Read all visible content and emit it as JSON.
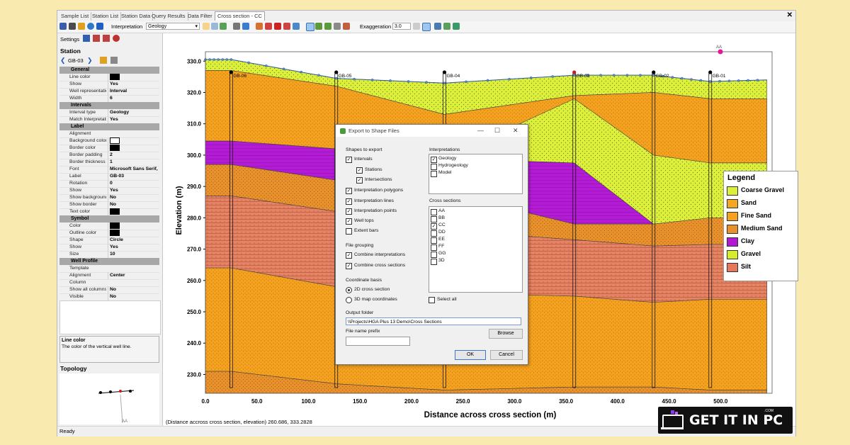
{
  "tabs": [
    {
      "label": "Sample List",
      "active": false
    },
    {
      "label": "Station List",
      "active": false
    },
    {
      "label": "Station Data",
      "active": false
    },
    {
      "label": "Query Results",
      "active": false
    },
    {
      "label": "Data Filter",
      "active": false
    },
    {
      "label": "Cross section - CC",
      "active": true
    }
  ],
  "toolbar": {
    "interpretation_label": "Interpretation",
    "interpretation_value": "Geology",
    "exaggeration_label": "Exaggeration",
    "exaggeration_value": "3.0"
  },
  "left_panel": {
    "settings_label": "Settings",
    "station_header": "Station",
    "station_id": "GB-03",
    "categories": {
      "general": "General",
      "intervals": "Intervals",
      "label": "Label",
      "symbol": "Symbol",
      "well_profile": "Well Profile"
    },
    "rows": {
      "line_color": "Line color",
      "show": "Show",
      "show_value": "Yes",
      "well_representation": "Well representation",
      "well_representation_value": "Interval",
      "width": "Width",
      "width_value": "6",
      "interval_type": "Interval type",
      "interval_type_value": "Geology",
      "match_interpretation": "Match Interpretation",
      "match_interpretation_value": "Yes",
      "alignment": "Alignment",
      "background_color": "Background color",
      "border_color": "Border color",
      "border_padding": "Border padding",
      "border_padding_value": "2",
      "border_thickness": "Border thickness",
      "border_thickness_value": "1",
      "font": "Font",
      "font_value": "Microsoft Sans Serif,",
      "label": "Label",
      "label_value": "GB-03",
      "rotation": "Rotation",
      "rotation_value": "0",
      "show_label": "Show",
      "show_label_value": "Yes",
      "show_background": "Show background",
      "show_background_value": "No",
      "show_border": "Show border",
      "show_border_value": "No",
      "text_color": "Text color",
      "color": "Color",
      "outline_color": "Outline color",
      "shape": "Shape",
      "shape_value": "Circle",
      "symbol_show": "Show",
      "symbol_show_value": "Yes",
      "size": "Size",
      "size_value": "10",
      "template": "Template",
      "wp_alignment": "Alignment",
      "wp_alignment_value": "Center",
      "column": "Column",
      "show_all_columns": "Show all columns",
      "show_all_columns_value": "No",
      "visible": "Visible",
      "visible_value": "No"
    },
    "description_title": "Line color",
    "description_text": "The color of the vertical well line.",
    "topology_header": "Topology",
    "topology_label_aa": "AA"
  },
  "section": {
    "y_axis_label": "Elevation (m)",
    "x_axis_label": "Distance across cross section (m)",
    "y_ticks": [
      "330.0",
      "320.0",
      "310.0",
      "300.0",
      "290.0",
      "280.0",
      "270.0",
      "260.0",
      "250.0",
      "240.0",
      "230.0"
    ],
    "x_ticks": [
      "0.0",
      "50.0",
      "100.0",
      "150.0",
      "200.0",
      "250.0",
      "300.0",
      "350.0",
      "400.0",
      "450.0",
      "500.0"
    ],
    "wells": [
      "GB-06",
      "GB-05",
      "GB-04",
      "GB-03",
      "GB-02",
      "GB-01"
    ],
    "marker_label": "AA"
  },
  "legend": {
    "title": "Legend",
    "items": [
      {
        "label": "Coarse Gravel",
        "color": "#dff24a"
      },
      {
        "label": "Sand",
        "color": "#f5a623"
      },
      {
        "label": "Fine Sand",
        "color": "#f4a21f"
      },
      {
        "label": "Medium Sand",
        "color": "#e8902a"
      },
      {
        "label": "Clay",
        "color": "#b218d4"
      },
      {
        "label": "Gravel",
        "color": "#d8ec2e"
      },
      {
        "label": "Silt",
        "color": "#e5775a"
      }
    ]
  },
  "dialog": {
    "title": "Export to Shape Files",
    "shapes_label": "Shapes to export",
    "shapes": [
      {
        "label": "Intervals",
        "checked": true
      },
      {
        "label": "Stations",
        "checked": true
      },
      {
        "label": "Intersections",
        "checked": true
      },
      {
        "label": "Interpretation polygons",
        "checked": true
      },
      {
        "label": "Interpretation lines",
        "checked": true
      },
      {
        "label": "Interpretation points",
        "checked": true
      },
      {
        "label": "Well tops",
        "checked": true
      },
      {
        "label": "Extent bars",
        "checked": false
      }
    ],
    "file_grouping_label": "File grouping",
    "file_grouping": [
      {
        "label": "Combine interpretations",
        "checked": true
      },
      {
        "label": "Combine cross sections",
        "checked": true
      }
    ],
    "coord_label": "Coordinate basis",
    "coord_options": [
      {
        "label": "2D cross section",
        "selected": true
      },
      {
        "label": "3D map coordinates",
        "selected": false
      }
    ],
    "interpretations_label": "Interpretations",
    "interpretations": [
      {
        "label": "Geology",
        "checked": true
      },
      {
        "label": "Hydrogeology",
        "checked": false
      },
      {
        "label": "Model",
        "checked": false
      }
    ],
    "cross_sections_label": "Cross sections",
    "cross_sections": [
      {
        "label": "AA",
        "checked": false
      },
      {
        "label": "BB",
        "checked": false
      },
      {
        "label": "CC",
        "checked": true
      },
      {
        "label": "DD",
        "checked": false
      },
      {
        "label": "EE",
        "checked": false
      },
      {
        "label": "FF",
        "checked": false
      },
      {
        "label": "GG",
        "checked": false
      },
      {
        "label": "3D",
        "checked": false
      }
    ],
    "select_all_label": "Select all",
    "output_folder_label": "Output folder",
    "output_folder_value": "\\\\Projects\\HGA Plus 13 Demo\\Cross Sections",
    "prefix_label": "File name prefix",
    "prefix_value": "",
    "browse_label": "Browse",
    "ok_label": "OK",
    "cancel_label": "Cancel"
  },
  "status": {
    "coords_text": "(Distance accross cross section, elevation)  260.686, 333.2828",
    "ready_text": "Ready"
  },
  "watermark": {
    "text": "GET IT IN PC",
    "small": ".COM"
  }
}
